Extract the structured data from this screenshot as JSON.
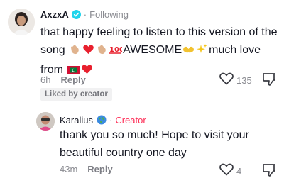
{
  "comments": [
    {
      "username": "AxzxA",
      "status": "Following",
      "separator": "·",
      "text_parts": [
        "that happy feeling to listen to this version of the song ",
        "AWESOME",
        "much love from "
      ],
      "time": "6h",
      "reply_label": "Reply",
      "likes": "135",
      "badge": "Liked by creator"
    },
    {
      "username": "Karalius",
      "role": "Creator",
      "separator": "·",
      "text": "thank you so much! Hope to visit your beautiful country one day",
      "time": "43m",
      "reply_label": "Reply",
      "likes": "4"
    }
  ],
  "colors": {
    "text": "#161823",
    "muted": "#8a8b91",
    "creator": "#fe2c55",
    "verified": "#20d5ec",
    "heart": "#fe2c55"
  },
  "icons": [
    "verified-badge-icon",
    "globe-icon",
    "heart-outline-icon",
    "dislike-icon"
  ]
}
